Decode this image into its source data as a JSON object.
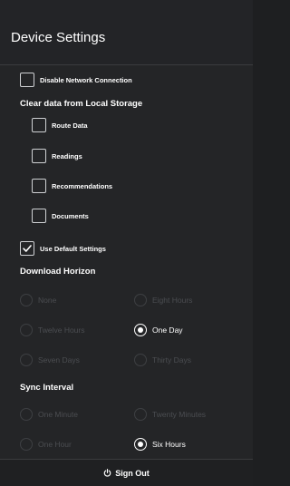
{
  "header": {
    "title": "Device Settings"
  },
  "network": {
    "label": "Disable Network Connection",
    "checked": false
  },
  "storage": {
    "title": "Clear data from Local Storage",
    "items": [
      {
        "label": "Route Data",
        "checked": false
      },
      {
        "label": "Readings",
        "checked": false
      },
      {
        "label": "Recommendations",
        "checked": false
      },
      {
        "label": "Documents",
        "checked": false
      }
    ]
  },
  "defaults": {
    "label": "Use Default Settings",
    "checked": true
  },
  "download_horizon": {
    "title": "Download Horizon",
    "options": [
      {
        "label": "None",
        "selected": false
      },
      {
        "label": "Eight Hours",
        "selected": false
      },
      {
        "label": "Twelve Hours",
        "selected": false
      },
      {
        "label": "One Day",
        "selected": true
      },
      {
        "label": "Seven Days",
        "selected": false
      },
      {
        "label": "Thirty Days",
        "selected": false
      }
    ]
  },
  "sync_interval": {
    "title": "Sync Interval",
    "options": [
      {
        "label": "One Minute",
        "selected": false
      },
      {
        "label": "Twenty Minutes",
        "selected": false
      },
      {
        "label": "One Hour",
        "selected": false
      },
      {
        "label": "Six Hours",
        "selected": true
      }
    ]
  },
  "footer": {
    "signout_label": "Sign Out",
    "signout_icon": "power-icon"
  },
  "colors": {
    "background": "#242527",
    "text": "#ffffff",
    "disabled_text": "#4b4d51",
    "border": "#cfd1d4"
  }
}
